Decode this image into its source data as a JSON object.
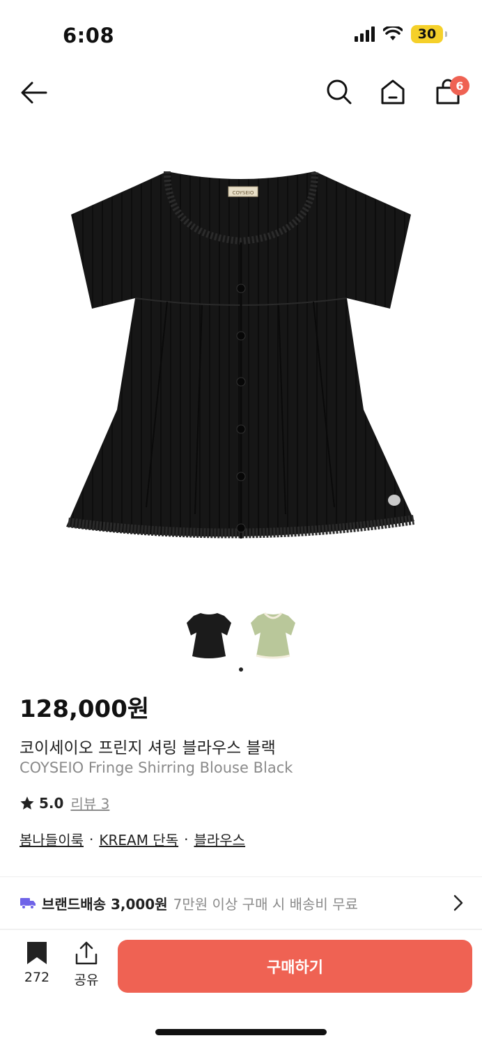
{
  "status_bar": {
    "time": "6:08",
    "battery": "30"
  },
  "nav": {
    "cart_count": "6"
  },
  "product": {
    "price": "128,000원",
    "name_ko": "코이세이오 프린지 셔링 블라우스 블랙",
    "name_en": "COYSEIO Fringe Shirring Blouse Black",
    "rating": "5.0",
    "reviews": "리뷰 3",
    "tags": [
      "봄나들이룩",
      "KREAM 단독",
      "블라우스"
    ],
    "tag_separator": "·",
    "label_text": "COYSEIO"
  },
  "thumbnails": [
    {
      "color": "#1b1b1b"
    },
    {
      "color": "#b9c79a"
    }
  ],
  "shipping": {
    "label": "브랜드배송 3,000원",
    "sub": "7만원 이상 구매 시 배송비 무료"
  },
  "bottom_bar": {
    "bookmark_count": "272",
    "share_label": "공유",
    "buy_label": "구매하기"
  },
  "colors": {
    "accent": "#ef6253",
    "badge": "#ef6253",
    "battery": "#f5d02a"
  },
  "icons": [
    "signal-icon",
    "wifi-icon",
    "battery-icon",
    "back-arrow-icon",
    "search-icon",
    "home-icon",
    "shopping-bag-icon",
    "star-icon",
    "truck-icon",
    "chevron-right-icon",
    "bookmark-icon",
    "share-icon"
  ]
}
